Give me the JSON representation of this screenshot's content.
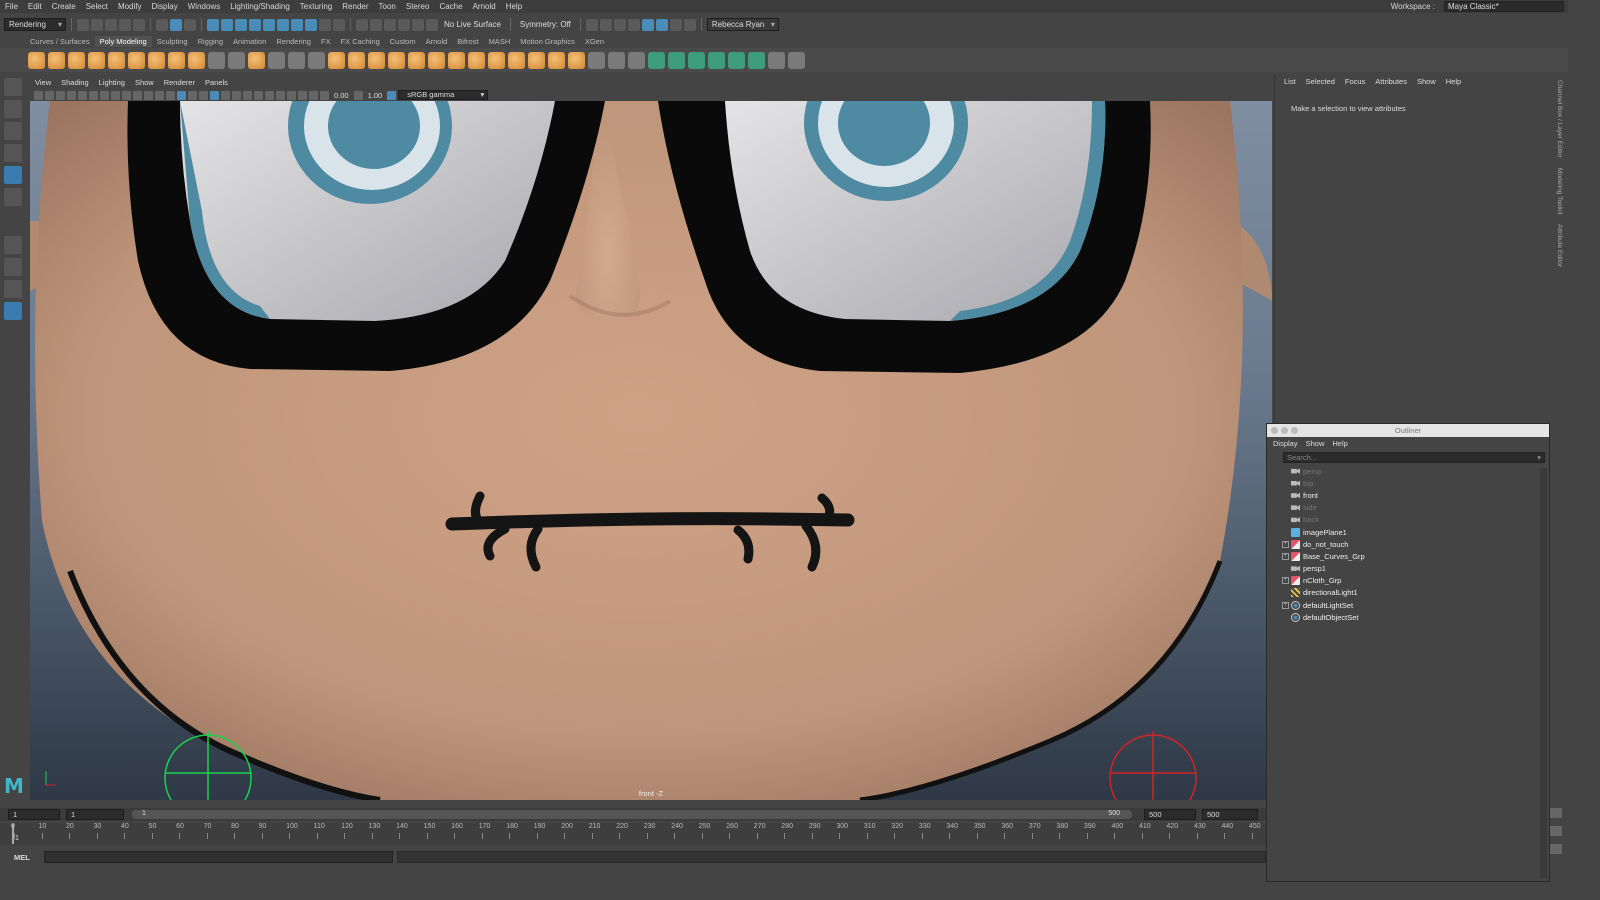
{
  "menubar": {
    "items": [
      "File",
      "Edit",
      "Create",
      "Select",
      "Modify",
      "Display",
      "Windows",
      "Lighting/Shading",
      "Texturing",
      "Render",
      "Toon",
      "Stereo",
      "Cache",
      "Arnold",
      "Help"
    ],
    "workspace_label": "Workspace :",
    "workspace_value": "Maya Classic*"
  },
  "statusline": {
    "menuset": "Rendering",
    "live_surface": "No Live Surface",
    "symmetry": "Symmetry: Off",
    "user": "Rebecca Ryan"
  },
  "shelf": {
    "tabs": [
      "Curves / Surfaces",
      "Poly Modeling",
      "Sculpting",
      "Rigging",
      "Animation",
      "Rendering",
      "FX",
      "FX Caching",
      "Custom",
      "Arnold",
      "Bifrost",
      "MASH",
      "Motion Graphics",
      "XGen"
    ],
    "active_tab": "Poly Modeling"
  },
  "panel": {
    "menu": [
      "View",
      "Shading",
      "Lighting",
      "Show",
      "Renderer",
      "Panels"
    ],
    "exposure": "0.00",
    "gamma_value": "1.00",
    "color_space": "sRGB gamma",
    "camera_label": "front -Z"
  },
  "time": {
    "start_field": "1",
    "current_field": "1",
    "range_start": "1",
    "range_end": "500",
    "end_field": "500",
    "anim_end_field": "500",
    "ticks": [
      "0",
      "10",
      "20",
      "30",
      "40",
      "50",
      "60",
      "70",
      "80",
      "90",
      "100",
      "110",
      "120",
      "130",
      "140",
      "150",
      "160",
      "170",
      "180",
      "190",
      "200",
      "210",
      "220",
      "230",
      "240",
      "250",
      "260",
      "270",
      "280",
      "290",
      "300",
      "310",
      "320",
      "330",
      "340",
      "350",
      "360",
      "370",
      "380",
      "390",
      "400",
      "410",
      "420",
      "430",
      "440",
      "450"
    ],
    "current_frame_label": "1"
  },
  "cmdline": {
    "mode": "MEL"
  },
  "attr_editor": {
    "menu": [
      "List",
      "Selected",
      "Focus",
      "Attributes",
      "Show",
      "Help"
    ],
    "message": "Make a selection to view attributes"
  },
  "side_tabs": [
    "Channel Box / Layer Editor",
    "Modeling Toolkit",
    "Attribute Editor"
  ],
  "outliner": {
    "title": "Outliner",
    "menu": [
      "Display",
      "Show",
      "Help"
    ],
    "search_placeholder": "Search...",
    "items": [
      {
        "label": "persp",
        "icon": "camera-icon",
        "dim": true,
        "expandable": false
      },
      {
        "label": "top",
        "icon": "camera-icon",
        "dim": true,
        "expandable": false
      },
      {
        "label": "front",
        "icon": "camera-icon",
        "dim": false,
        "expandable": false
      },
      {
        "label": "side",
        "icon": "camera-icon",
        "dim": true,
        "expandable": false
      },
      {
        "label": "back",
        "icon": "camera-icon",
        "dim": true,
        "expandable": false
      },
      {
        "label": "imagePlane1",
        "icon": "image-plane-icon",
        "dim": false,
        "expandable": false
      },
      {
        "label": "do_not_touch",
        "icon": "group-icon",
        "dim": false,
        "expandable": true
      },
      {
        "label": "Base_Curves_Grp",
        "icon": "group-icon",
        "dim": false,
        "expandable": true
      },
      {
        "label": "persp1",
        "icon": "camera-icon",
        "dim": false,
        "expandable": false
      },
      {
        "label": "nCloth_Grp",
        "icon": "group-icon",
        "dim": false,
        "expandable": true
      },
      {
        "label": "directionalLight1",
        "icon": "light-icon",
        "dim": false,
        "expandable": false
      },
      {
        "label": "defaultLightSet",
        "icon": "set-icon",
        "dim": false,
        "expandable": true
      },
      {
        "label": "defaultObjectSet",
        "icon": "set-icon",
        "dim": false,
        "expandable": false
      }
    ]
  },
  "colors": {
    "accent": "#4a8cb8",
    "maya_logo": "#3fb6c9",
    "skin": "#c49a80",
    "iris": "#4f8aa3"
  }
}
